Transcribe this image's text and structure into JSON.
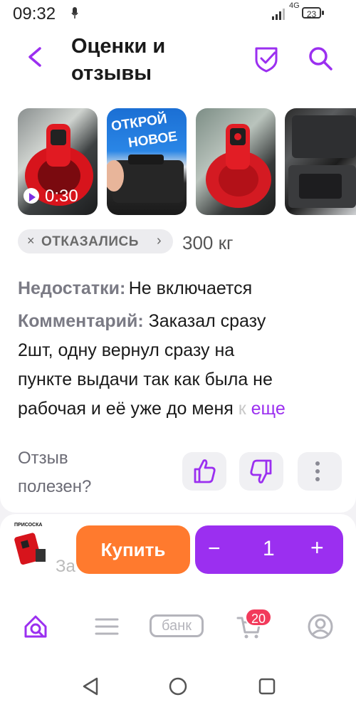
{
  "status_bar": {
    "time": "09:32",
    "network": "4G",
    "battery": "23"
  },
  "header": {
    "title_line1": "Оценки и",
    "title_line2": "отзывы"
  },
  "media": {
    "video_duration": "0:30",
    "banner_line1": "ОТКРОЙ",
    "banner_line2": "НОВОЕ"
  },
  "review": {
    "status_chip": "ОТКАЗАЛИСЬ",
    "chip_arrow": "›",
    "chip_close": "×",
    "variant": "300 кг",
    "cons_label": "Недостатки:",
    "cons_text": "Не включается",
    "comment_label": "Комментарий:",
    "comment_line1": "Заказал сразу",
    "comment_line2": "2шт, одну вернул сразу на",
    "comment_line3": "пункте выдачи так как была не",
    "comment_line4": "рабочая и её уже до меня",
    "comment_fade": "к",
    "more_link": "еще",
    "useful_line1": "Отзыв",
    "useful_line2": "полезен?"
  },
  "buy_bar": {
    "product_thumb_text": "ПРИСОСКА",
    "faint_text": "За",
    "buy_label": "Купить",
    "minus": "−",
    "quantity": "1",
    "plus": "+"
  },
  "tab_bar": {
    "bank_label": "банк",
    "cart_count": "20"
  },
  "colors": {
    "accent": "#9b2ff0",
    "buy": "#ff7a2e",
    "badge": "#f23a5b"
  }
}
